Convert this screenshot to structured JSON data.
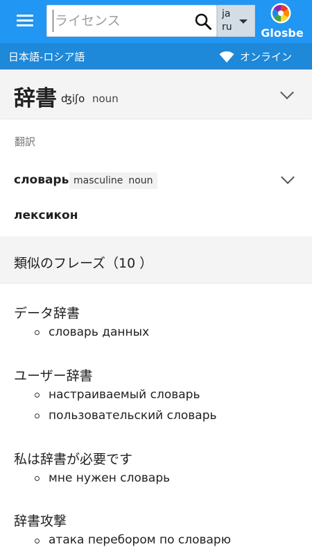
{
  "appbar": {
    "search_placeholder": "ライセンス",
    "lang_from": "ja",
    "lang_to": "ru",
    "logo_text": "Glosbe"
  },
  "subbar": {
    "dictionary": "日本語-ロシア語",
    "status": "オンライン"
  },
  "entry": {
    "headword": "辞書",
    "pronunciation": "ʤiʃo",
    "pos": "noun"
  },
  "translations": {
    "label": "翻訳",
    "items": [
      {
        "word": "словарь",
        "gender": "masculine",
        "pos": "noun"
      },
      {
        "word": "лексикон"
      }
    ]
  },
  "phrases": {
    "title": "類似のフレーズ（10 ）",
    "groups": [
      {
        "head": "データ辞書",
        "items": [
          "словарь данных"
        ]
      },
      {
        "head": "ユーザー辞書",
        "items": [
          "настраиваемый словарь",
          "пользовательский словарь"
        ]
      },
      {
        "head": "私は辞書が必要です",
        "items": [
          "мне нужен словарь"
        ]
      },
      {
        "head": "辞書攻撃",
        "items": [
          "атака перебором по словарю"
        ]
      }
    ]
  },
  "colors": {
    "appbar": "#2196f3",
    "subbar": "#1e88d9"
  }
}
